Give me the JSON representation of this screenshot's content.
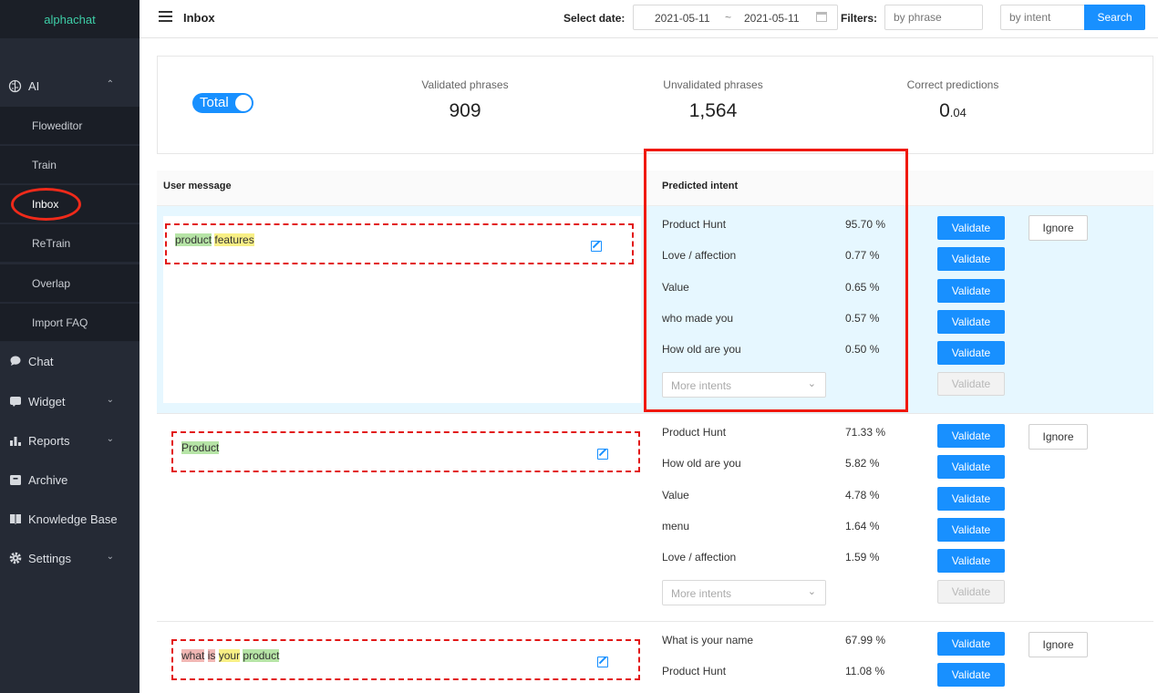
{
  "sidebar": {
    "logo": "alphachat",
    "ai_label": "AI",
    "ai_items": [
      {
        "label": "Floweditor"
      },
      {
        "label": "Train"
      },
      {
        "label": "Inbox"
      },
      {
        "label": "ReTrain"
      },
      {
        "label": "Overlap"
      },
      {
        "label": "Import FAQ"
      }
    ],
    "groups": [
      {
        "label": "Chat",
        "icon": "chat-icon",
        "has_chevron": false
      },
      {
        "label": "Widget",
        "icon": "widget-icon",
        "has_chevron": true
      },
      {
        "label": "Reports",
        "icon": "reports-icon",
        "has_chevron": true
      },
      {
        "label": "Archive",
        "icon": "archive-icon",
        "has_chevron": false
      },
      {
        "label": "Knowledge Base",
        "icon": "book-icon",
        "has_chevron": false
      },
      {
        "label": "Settings",
        "icon": "gear-icon",
        "has_chevron": true
      }
    ],
    "active_item": "Inbox"
  },
  "header": {
    "title": "Inbox",
    "select_date_label": "Select date:",
    "date_from": "2021-05-11",
    "date_sep": "~",
    "date_to": "2021-05-11",
    "filters_label": "Filters:",
    "phrase_placeholder": "by phrase",
    "intent_placeholder": "by intent",
    "search_label": "Search"
  },
  "stats": {
    "toggle_label": "Total",
    "validated_label": "Validated phrases",
    "validated_value": "909",
    "unvalidated_label": "Unvalidated phrases",
    "unvalidated_value": "1,564",
    "correct_label": "Correct predictions",
    "correct_value_int": "0",
    "correct_value_dec": ".04"
  },
  "table": {
    "col_message": "User message",
    "col_intent": "Predicted intent",
    "validate_label": "Validate",
    "ignore_label": "Ignore",
    "more_intents_placeholder": "More intents",
    "rows": [
      {
        "message_parts": [
          {
            "text": "product",
            "hl": "g"
          },
          {
            "text": " ",
            "hl": ""
          },
          {
            "text": "features",
            "hl": "y"
          }
        ],
        "intents": [
          {
            "name": "Product Hunt",
            "pct": "95.70 %"
          },
          {
            "name": "Love / affection",
            "pct": "0.77 %"
          },
          {
            "name": "Value",
            "pct": "0.65 %"
          },
          {
            "name": "who made you",
            "pct": "0.57 %"
          },
          {
            "name": "How old are you",
            "pct": "0.50 %"
          }
        ]
      },
      {
        "message_parts": [
          {
            "text": "Product",
            "hl": "g"
          }
        ],
        "intents": [
          {
            "name": "Product Hunt",
            "pct": "71.33 %"
          },
          {
            "name": "How old are you",
            "pct": "5.82 %"
          },
          {
            "name": "Value",
            "pct": "4.78 %"
          },
          {
            "name": "menu",
            "pct": "1.64 %"
          },
          {
            "name": "Love / affection",
            "pct": "1.59 %"
          }
        ]
      },
      {
        "message_parts": [
          {
            "text": "what",
            "hl": "p"
          },
          {
            "text": " ",
            "hl": ""
          },
          {
            "text": "is",
            "hl": "p"
          },
          {
            "text": " ",
            "hl": ""
          },
          {
            "text": "your",
            "hl": "y"
          },
          {
            "text": " ",
            "hl": ""
          },
          {
            "text": "product",
            "hl": "g"
          }
        ],
        "intents": [
          {
            "name": "What is your name",
            "pct": "67.99 %"
          },
          {
            "name": "Product Hunt",
            "pct": "11.08 %"
          }
        ]
      }
    ]
  },
  "colors": {
    "accent": "#1890ff",
    "sidebar_bg": "#252a35",
    "selected_row_bg": "#e6f7ff",
    "annotation_red": "#f0190d"
  }
}
